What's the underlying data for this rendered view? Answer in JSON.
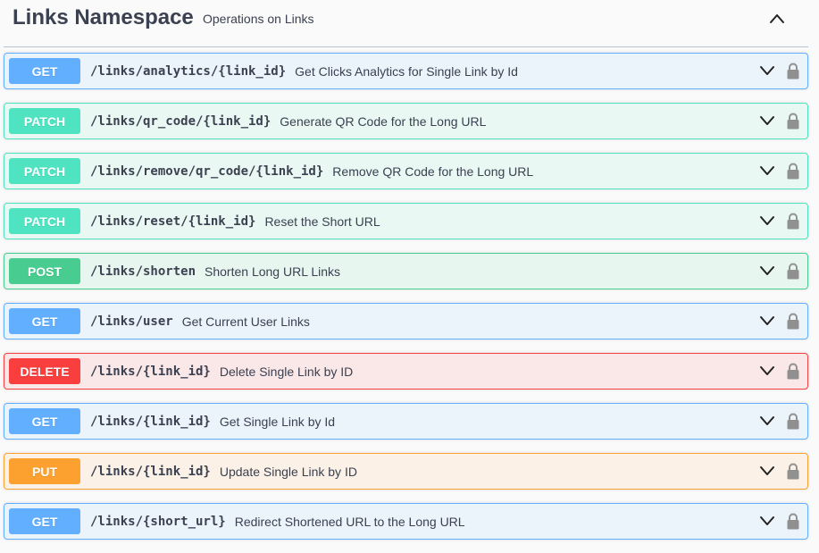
{
  "tag": {
    "title": "Links Namespace",
    "description": "Operations on Links"
  },
  "colors": {
    "GET": "#61affe",
    "PATCH": "#50e3c2",
    "POST": "#49cc90",
    "DELETE": "#f93e3e",
    "PUT": "#fca130"
  },
  "operations": [
    {
      "method": "GET",
      "path": "/links/analytics/{link_id}",
      "summary": "Get Clicks Analytics for Single Link by Id"
    },
    {
      "method": "PATCH",
      "path": "/links/qr_code/{link_id}",
      "summary": "Generate QR Code for the Long URL"
    },
    {
      "method": "PATCH",
      "path": "/links/remove/qr_code/{link_id}",
      "summary": "Remove QR Code for the Long URL"
    },
    {
      "method": "PATCH",
      "path": "/links/reset/{link_id}",
      "summary": "Reset the Short URL"
    },
    {
      "method": "POST",
      "path": "/links/shorten",
      "summary": "Shorten Long URL Links"
    },
    {
      "method": "GET",
      "path": "/links/user",
      "summary": "Get Current User Links"
    },
    {
      "method": "DELETE",
      "path": "/links/{link_id}",
      "summary": "Delete Single Link by ID"
    },
    {
      "method": "GET",
      "path": "/links/{link_id}",
      "summary": "Get Single Link by Id"
    },
    {
      "method": "PUT",
      "path": "/links/{link_id}",
      "summary": "Update Single Link by ID"
    },
    {
      "method": "GET",
      "path": "/links/{short_url}",
      "summary": "Redirect Shortened URL to the Long URL"
    }
  ],
  "icons": {
    "collapse": "chevron-up-icon",
    "expand": "chevron-down-icon",
    "auth": "lock-icon"
  }
}
